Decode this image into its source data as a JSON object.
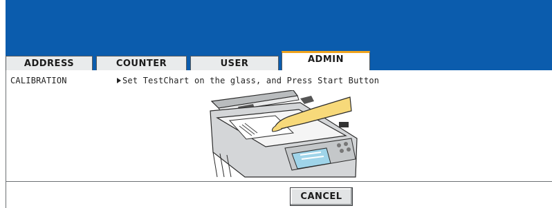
{
  "tabs": [
    {
      "label": "ADDRESS"
    },
    {
      "label": "COUNTER"
    },
    {
      "label": "USER"
    },
    {
      "label": "ADMIN",
      "active": true
    }
  ],
  "panel": {
    "section": "CALIBRATION",
    "instruction": "Set TestChart on the glass, and Press Start Button"
  },
  "buttons": {
    "cancel": "CANCEL"
  },
  "icons": {
    "instruction_marker": "right-triangle-icon",
    "illustration": "copier-scanner-illustration"
  },
  "colors": {
    "header_blue": "#0b5cad",
    "active_tab_accent": "#f0a31d",
    "hand_yellow": "#f7d97a"
  }
}
